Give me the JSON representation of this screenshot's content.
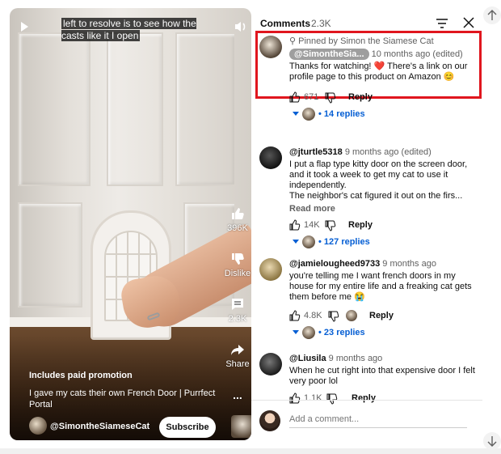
{
  "video": {
    "caption": "left to resolve is to see how the casts like it I open",
    "actions": {
      "likes": "396K",
      "dislike_label": "Dislike",
      "comments_count": "2.3K",
      "share_label": "Share",
      "more_label": "..."
    },
    "paid_promotion": "Includes paid promotion",
    "title": "I gave my cats their own French Door | Purrfect Portal",
    "channel": "@SimontheSiameseCat",
    "subscribe_label": "Subscribe"
  },
  "comments_panel": {
    "title": "Comments",
    "count": "2.3K",
    "comments": [
      {
        "pinned_label": "Pinned by Simon the Siamese Cat",
        "author": "@SimontheSia...",
        "time": "10 months ago (edited)",
        "text_before_heart": "Thanks for watching! ",
        "heart": "❤️",
        "text_after_heart": " There's a link on our profile page to this product on Amazon 😊",
        "likes": "671",
        "reply_label": "Reply",
        "replies": "• 14 replies"
      },
      {
        "author": "@jturtle5318",
        "time": "9 months ago (edited)",
        "text": "I put a flap type kitty door on the screen door, and it took a week to get my cat to use it independently.",
        "text2": "The neighbor's cat figured it out on the firs...",
        "read_more": "Read more",
        "likes": "14K",
        "reply_label": "Reply",
        "replies": "• 127 replies"
      },
      {
        "author": "@jamielougheed9733",
        "time": "9 months ago",
        "text": "you're telling me I want french doors in my house for my entire life and a freaking cat gets them before me 😭",
        "likes": "4.8K",
        "reply_label": "Reply",
        "replies": "• 23 replies"
      },
      {
        "author": "@Liusila",
        "time": "9 months ago",
        "text": "When he cut right into that expensive door I felt very poor lol",
        "likes": "1.1K",
        "reply_label": "Reply"
      }
    ],
    "add_comment_placeholder": "Add a comment..."
  },
  "colors": {
    "link_blue": "#065fd4",
    "highlight_red": "#e0161e",
    "text_primary": "#0f0f0f",
    "text_secondary": "#606060"
  }
}
